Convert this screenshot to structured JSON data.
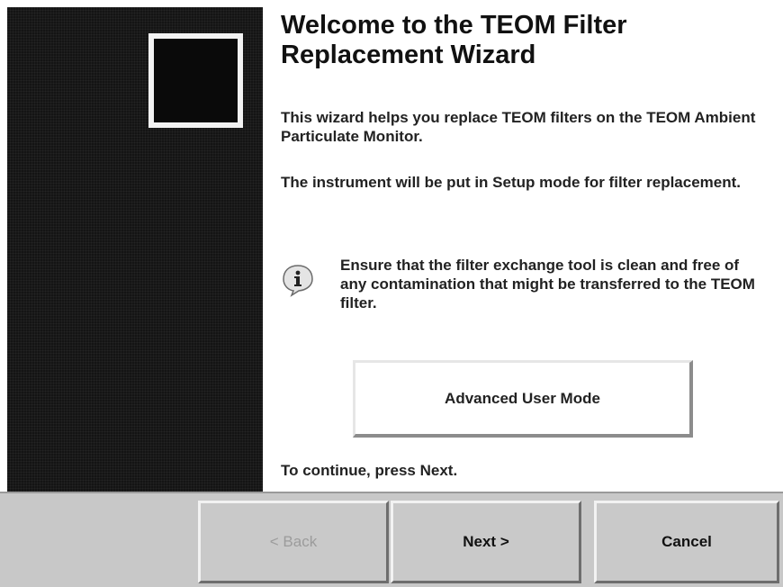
{
  "wizard": {
    "title": "Welcome to the TEOM Filter Replacement Wizard",
    "intro": "This wizard helps you replace TEOM filters on the TEOM Ambient Particulate Monitor.",
    "setup_note": "The instrument will be put in Setup mode for filter replacement.",
    "info": {
      "icon": "info-icon",
      "text": "Ensure that the filter exchange tool is clean and free of any contamination that might be transferred to the TEOM filter."
    },
    "advanced_button_label": "Advanced User Mode",
    "continue_text": "To continue, press Next."
  },
  "buttons": {
    "back_label": "< Back",
    "back_enabled": false,
    "next_label": "Next >",
    "cancel_label": "Cancel"
  },
  "colors": {
    "banner": "#141414",
    "bottom_bar": "#c8c8c8",
    "disabled_text": "#9c9c9c"
  }
}
